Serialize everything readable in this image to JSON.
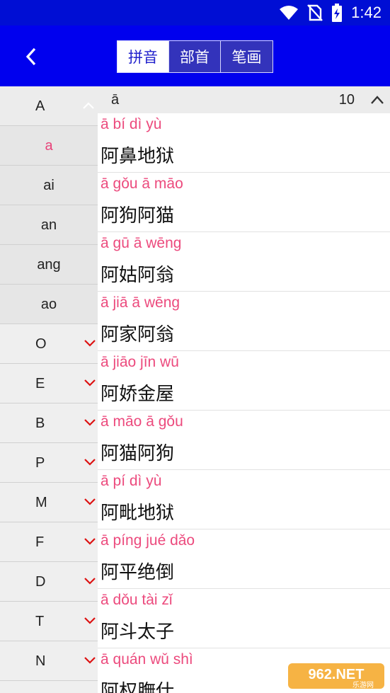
{
  "status_bar": {
    "time": "1:42"
  },
  "header": {
    "tabs": [
      {
        "label": "拼音",
        "active": true
      },
      {
        "label": "部首",
        "active": false
      },
      {
        "label": "笔画",
        "active": false
      }
    ]
  },
  "index": {
    "rows": [
      {
        "label": "A",
        "type": "letter",
        "expanded": true
      },
      {
        "label": "a",
        "type": "sub",
        "selected": true
      },
      {
        "label": "ai",
        "type": "sub"
      },
      {
        "label": "an",
        "type": "sub"
      },
      {
        "label": "ang",
        "type": "sub"
      },
      {
        "label": "ao",
        "type": "sub"
      },
      {
        "label": "O",
        "type": "letter"
      },
      {
        "label": "E",
        "type": "letter"
      },
      {
        "label": "B",
        "type": "letter"
      },
      {
        "label": "P",
        "type": "letter"
      },
      {
        "label": "M",
        "type": "letter"
      },
      {
        "label": "F",
        "type": "letter"
      },
      {
        "label": "D",
        "type": "letter"
      },
      {
        "label": "T",
        "type": "letter"
      },
      {
        "label": "N",
        "type": "letter"
      }
    ]
  },
  "section": {
    "pinyin": "ā",
    "count": "10"
  },
  "entries": [
    {
      "pinyin": "ā bí dì yù",
      "word": "阿鼻地狱"
    },
    {
      "pinyin": "ā gǒu ā māo",
      "word": "阿狗阿猫"
    },
    {
      "pinyin": "ā gū ā wēng",
      "word": "阿姑阿翁"
    },
    {
      "pinyin": "ā jiā ā wēng",
      "word": "阿家阿翁"
    },
    {
      "pinyin": "ā jiāo jīn wū",
      "word": "阿娇金屋"
    },
    {
      "pinyin": "ā māo ā gǒu",
      "word": "阿猫阿狗"
    },
    {
      "pinyin": "ā pí dì yù",
      "word": "阿毗地狱"
    },
    {
      "pinyin": "ā píng jué dǎo",
      "word": "阿平绝倒"
    },
    {
      "pinyin": "ā dǒu tài zǐ",
      "word": "阿斗太子"
    },
    {
      "pinyin": "ā quán wǔ shì",
      "word": "阿权膴仕"
    }
  ],
  "colors": {
    "accent": "#0000ee",
    "pinyin": "#ec4a7d",
    "chevron": "#dd1111"
  },
  "watermark": {
    "text": "962.NET",
    "subtext": "乐游网"
  }
}
